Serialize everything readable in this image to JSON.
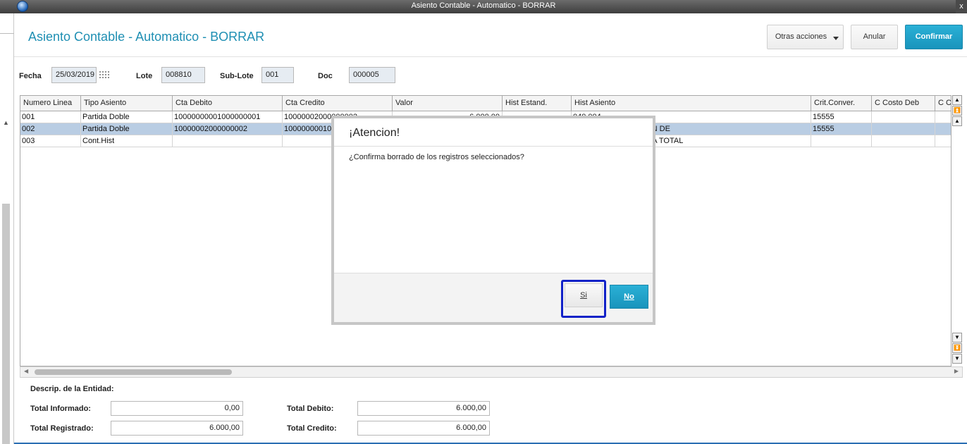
{
  "window": {
    "title": "Asiento Contable - Automatico - BORRAR",
    "close_glyph": "x"
  },
  "page": {
    "title": "Asiento Contable - Automatico - BORRAR"
  },
  "toolbar": {
    "more_label": "Otras acciones",
    "cancel_label": "Anular",
    "confirm_label": "Confirmar"
  },
  "filters": {
    "fecha_label": "Fecha",
    "fecha_value": "25/03/2019",
    "lote_label": "Lote",
    "lote_value": "008810",
    "sublote_label": "Sub-Lote",
    "sublote_value": "001",
    "doc_label": "Doc",
    "doc_value": "000005"
  },
  "grid": {
    "columns": [
      "Numero Linea",
      "Tipo Asiento",
      "Cta Debito",
      "Cta Credito",
      "Valor",
      "Hist Estand.",
      "Hist Asiento",
      "Crit.Conver.",
      "C Costo Deb",
      "C C"
    ],
    "rows": [
      {
        "cells": [
          "001",
          "Partida Doble",
          "10000000001000000001",
          "10000002000000002",
          "6.000,00",
          "",
          "040.004",
          "15555",
          "",
          ""
        ]
      },
      {
        "cells": [
          "002",
          "Partida Doble",
          "10000002000000002",
          "10000000010000000001",
          "",
          "",
          "ENTRADA - INCLUSION DE",
          "15555",
          "",
          ""
        ],
        "selected": true
      },
      {
        "cells": [
          "003",
          "Cont.Hist",
          "",
          "",
          "",
          "",
          "ADQUISICION/MEJORA TOTAL",
          "",
          "",
          ""
        ]
      }
    ]
  },
  "footer": {
    "entity_label": "Descrip. de la Entidad:",
    "total_informado_label": "Total Informado:",
    "total_informado_value": "0,00",
    "total_registrado_label": "Total Registrado:",
    "total_registrado_value": "6.000,00",
    "total_debito_label": "Total Debito:",
    "total_debito_value": "6.000,00",
    "total_credito_label": "Total Credito:",
    "total_credito_value": "6.000,00"
  },
  "modal": {
    "title": "¡Atencion!",
    "message": "¿Confirma borrado de los registros seleccionados?",
    "yes_label": "Si",
    "no_label": "No"
  },
  "colors": {
    "accent": "#1f8fb3",
    "primary_button": "#1994bc",
    "selected_row": "#b9cde3",
    "focus_ring": "#1222c8"
  }
}
